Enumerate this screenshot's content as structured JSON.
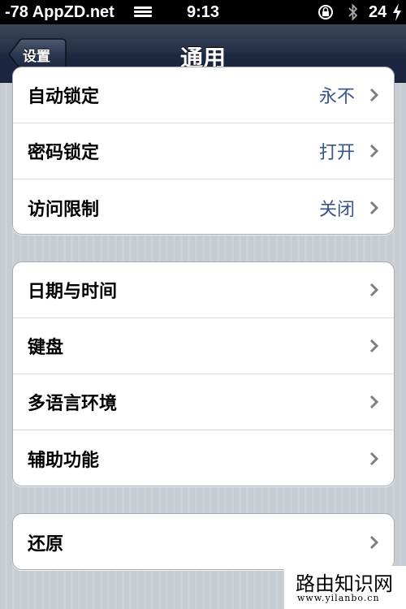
{
  "status_bar": {
    "carrier": "-78 AppZD.net",
    "time": "9:13",
    "battery": "24"
  },
  "nav": {
    "back_label": "设置",
    "title": "通用"
  },
  "groups": [
    {
      "rows": [
        {
          "label": "自动锁定",
          "value": "永不"
        },
        {
          "label": "密码锁定",
          "value": "打开"
        },
        {
          "label": "访问限制",
          "value": "关闭"
        }
      ]
    },
    {
      "rows": [
        {
          "label": "日期与时间"
        },
        {
          "label": "键盘"
        },
        {
          "label": "多语言环境"
        },
        {
          "label": "辅助功能"
        }
      ]
    },
    {
      "rows": [
        {
          "label": "还原"
        }
      ]
    }
  ],
  "watermark": {
    "title": "路由知识网",
    "url": "www.yilanbo.cn"
  },
  "icons": {
    "signal": "signal-bars-icon",
    "lock": "rotation-lock-icon",
    "bluetooth": "bluetooth-icon",
    "charge": "charging-bolt-icon",
    "chevron": "chevron-right-icon"
  },
  "colors": {
    "value_text": "#385487",
    "nav_bar": "#1b2540",
    "background": "#c5ccd4"
  }
}
